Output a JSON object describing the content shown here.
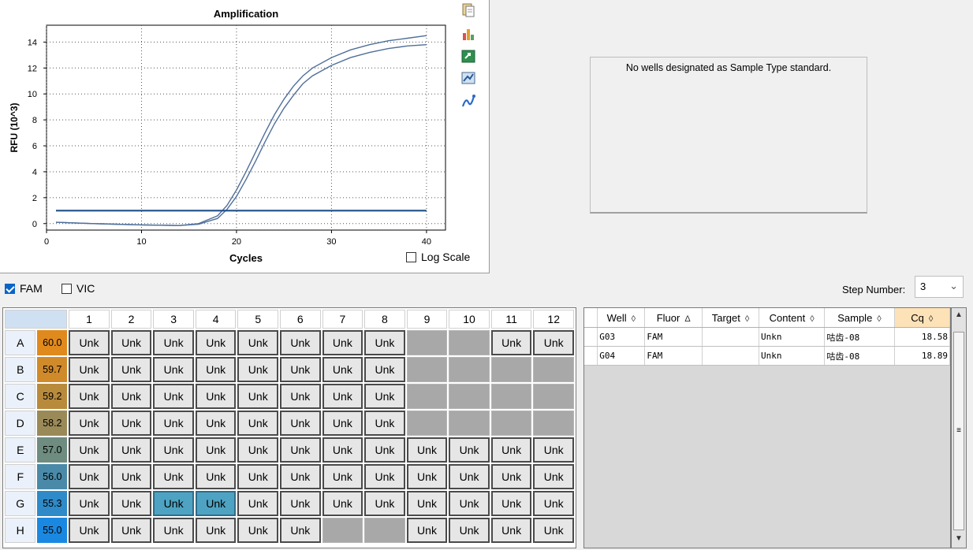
{
  "chart": {
    "title": "Amplification",
    "xlabel": "Cycles",
    "ylabel": "RFU (10^3)",
    "x_ticks": [
      "0",
      "10",
      "20",
      "30",
      "40"
    ],
    "y_ticks": [
      "0",
      "2",
      "4",
      "6",
      "8",
      "10",
      "12",
      "14"
    ],
    "log_scale_label": "Log Scale",
    "log_scale_checked": false
  },
  "chart_data": {
    "type": "line",
    "title": "Amplification",
    "xlabel": "Cycles",
    "ylabel": "RFU (10^3)",
    "xlim": [
      0,
      42
    ],
    "ylim": [
      -0.5,
      15.3
    ],
    "grid": true,
    "x": [
      1,
      5,
      10,
      14,
      16,
      18,
      19,
      20,
      21,
      22,
      23,
      24,
      25,
      26,
      27,
      28,
      30,
      32,
      34,
      36,
      38,
      40
    ],
    "series": [
      {
        "values": [
          0.1,
          0.0,
          -0.1,
          -0.15,
          0.0,
          0.6,
          1.4,
          2.6,
          4.0,
          5.5,
          7.0,
          8.4,
          9.6,
          10.6,
          11.4,
          12.0,
          12.8,
          13.4,
          13.8,
          14.1,
          14.3,
          14.5
        ]
      },
      {
        "values": [
          0.1,
          0.0,
          -0.1,
          -0.15,
          -0.05,
          0.4,
          1.1,
          2.1,
          3.4,
          4.8,
          6.3,
          7.7,
          8.9,
          9.9,
          10.8,
          11.4,
          12.2,
          12.8,
          13.2,
          13.5,
          13.7,
          13.8
        ]
      },
      {
        "values": [
          1.0,
          1.0,
          1.0,
          1.0,
          1.0,
          1.0,
          1.0,
          1.0,
          1.0,
          1.0,
          1.0,
          1.0,
          1.0,
          1.0,
          1.0,
          1.0,
          1.0,
          1.0,
          1.0,
          1.0,
          1.0,
          1.0
        ]
      }
    ],
    "colors": {
      "curves": "#4f6f9a",
      "threshold": "#1f4f8a"
    }
  },
  "tool_icons": [
    "copy-icon",
    "chart-settings-icon",
    "export-icon",
    "print-icon",
    "trace-icon"
  ],
  "standard": {
    "message": "No wells designated as Sample Type standard."
  },
  "fluors": [
    {
      "label": "FAM",
      "checked": true
    },
    {
      "label": "VIC",
      "checked": false
    }
  ],
  "step": {
    "label": "Step Number:",
    "value": "3"
  },
  "plate": {
    "columns": [
      "1",
      "2",
      "3",
      "4",
      "5",
      "6",
      "7",
      "8",
      "9",
      "10",
      "11",
      "12"
    ],
    "rows": [
      {
        "label": "A",
        "temp": "60.0",
        "temp_color": "#e08a1e",
        "wells": [
          "Unk",
          "Unk",
          "Unk",
          "Unk",
          "Unk",
          "Unk",
          "Unk",
          "Unk",
          "",
          "",
          "Unk",
          "Unk"
        ]
      },
      {
        "label": "B",
        "temp": "59.7",
        "temp_color": "#d08a2a",
        "wells": [
          "Unk",
          "Unk",
          "Unk",
          "Unk",
          "Unk",
          "Unk",
          "Unk",
          "Unk",
          "",
          "",
          "",
          ""
        ]
      },
      {
        "label": "C",
        "temp": "59.2",
        "temp_color": "#b88a3c",
        "wells": [
          "Unk",
          "Unk",
          "Unk",
          "Unk",
          "Unk",
          "Unk",
          "Unk",
          "Unk",
          "",
          "",
          "",
          ""
        ]
      },
      {
        "label": "D",
        "temp": "58.2",
        "temp_color": "#9a8a58",
        "wells": [
          "Unk",
          "Unk",
          "Unk",
          "Unk",
          "Unk",
          "Unk",
          "Unk",
          "Unk",
          "",
          "",
          "",
          ""
        ]
      },
      {
        "label": "E",
        "temp": "57.0",
        "temp_color": "#6e8c80",
        "wells": [
          "Unk",
          "Unk",
          "Unk",
          "Unk",
          "Unk",
          "Unk",
          "Unk",
          "Unk",
          "Unk",
          "Unk",
          "Unk",
          "Unk"
        ]
      },
      {
        "label": "F",
        "temp": "56.0",
        "temp_color": "#4a8aa8",
        "wells": [
          "Unk",
          "Unk",
          "Unk",
          "Unk",
          "Unk",
          "Unk",
          "Unk",
          "Unk",
          "Unk",
          "Unk",
          "Unk",
          "Unk"
        ]
      },
      {
        "label": "G",
        "temp": "55.3",
        "temp_color": "#2e8ac8",
        "wells": [
          "Unk",
          "Unk",
          "Unk",
          "Unk",
          "Unk",
          "Unk",
          "Unk",
          "Unk",
          "Unk",
          "Unk",
          "Unk",
          "Unk"
        ]
      },
      {
        "label": "H",
        "temp": "55.0",
        "temp_color": "#1a88e0",
        "wells": [
          "Unk",
          "Unk",
          "Unk",
          "Unk",
          "Unk",
          "Unk",
          "",
          "",
          "Unk",
          "Unk",
          "Unk",
          "Unk"
        ]
      }
    ],
    "selected": [
      "G3",
      "G4"
    ]
  },
  "results": {
    "headers": [
      {
        "label": "Well",
        "sort": "◊"
      },
      {
        "label": "Fluor",
        "sort": "Δ"
      },
      {
        "label": "Target",
        "sort": "◊"
      },
      {
        "label": "Content",
        "sort": "◊"
      },
      {
        "label": "Sample",
        "sort": "◊"
      },
      {
        "label": "Cq",
        "sort": "◊"
      }
    ],
    "rows": [
      [
        "G03",
        "FAM",
        "",
        "Unkn",
        "咕齿-08",
        "18.58"
      ],
      [
        "G04",
        "FAM",
        "",
        "Unkn",
        "咕齿-08",
        "18.89"
      ]
    ]
  }
}
